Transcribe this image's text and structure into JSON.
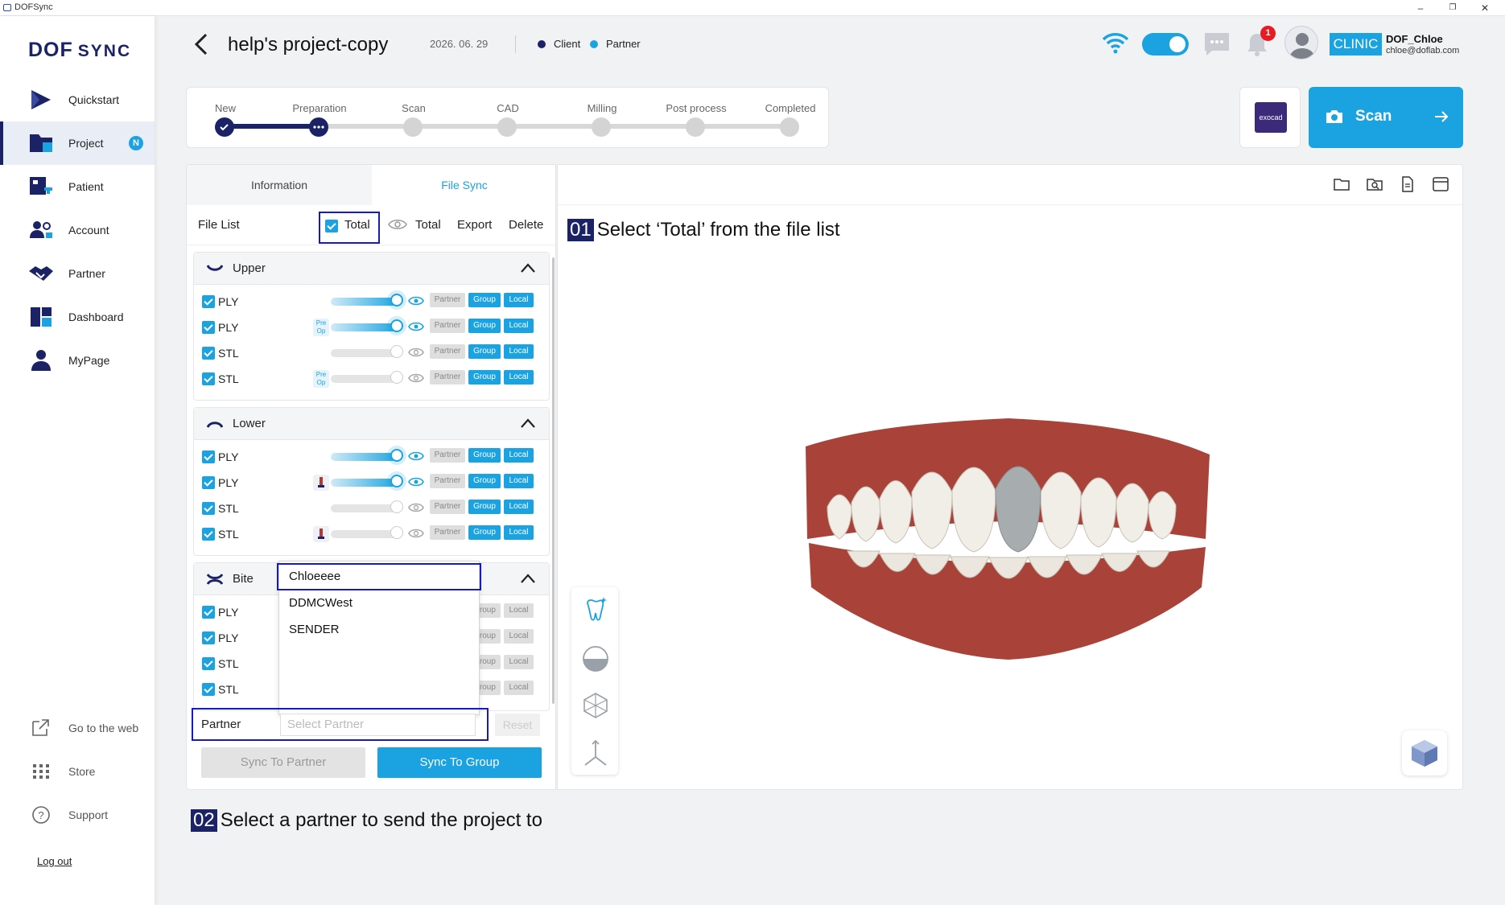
{
  "window": {
    "title": "DOFSync",
    "minimize": "–",
    "restore": "❐",
    "close": "✕"
  },
  "logo": {
    "part1": "DOF",
    "part2": "SYNC"
  },
  "sidebar": {
    "items": [
      {
        "label": "Quickstart",
        "icon": "play-icon"
      },
      {
        "label": "Project",
        "icon": "folder-icon",
        "badge": "N",
        "active": true
      },
      {
        "label": "Patient",
        "icon": "patient-icon"
      },
      {
        "label": "Account",
        "icon": "account-icon"
      },
      {
        "label": "Partner",
        "icon": "handshake-icon"
      },
      {
        "label": "Dashboard",
        "icon": "dashboard-icon"
      },
      {
        "label": "MyPage",
        "icon": "person-icon"
      }
    ],
    "bottom": [
      {
        "label": "Go to the web",
        "icon": "external-link-icon"
      },
      {
        "label": "Store",
        "icon": "grid-icon"
      },
      {
        "label": "Support",
        "icon": "help-icon"
      }
    ],
    "logout": "Log out"
  },
  "header": {
    "title": "help's project-copy",
    "date": "2026. 06. 29",
    "legend": [
      {
        "label": "Client",
        "color": "#1b2366"
      },
      {
        "label": "Partner",
        "color": "#1aa3e0"
      }
    ],
    "notification_count": "1",
    "role": "CLINIC",
    "user_name": "DOF_Chloe",
    "user_email": "chloe@doflab.com"
  },
  "stepper": {
    "steps": [
      "New",
      "Preparation",
      "Scan",
      "CAD",
      "Milling",
      "Post process",
      "Completed"
    ],
    "current_index": 1
  },
  "actions": {
    "exocad_label": "exocad",
    "scan_label": "Scan"
  },
  "tabs": {
    "information": "Information",
    "file_sync": "File Sync"
  },
  "file_list": {
    "label": "File List",
    "total_check": "Total",
    "total_view": "Total",
    "export": "Export",
    "delete": "Delete"
  },
  "chips": {
    "partner": "Partner",
    "group": "Group",
    "local": "Local"
  },
  "groups": [
    {
      "name": "Upper",
      "files": [
        {
          "type": "PLY",
          "tag": "",
          "slider_on": true
        },
        {
          "type": "PLY",
          "tag": "preop",
          "slider_on": true
        },
        {
          "type": "STL",
          "tag": "",
          "slider_on": false
        },
        {
          "type": "STL",
          "tag": "preop",
          "slider_on": false
        }
      ]
    },
    {
      "name": "Lower",
      "files": [
        {
          "type": "PLY",
          "tag": "",
          "slider_on": true
        },
        {
          "type": "PLY",
          "tag": "marker",
          "slider_on": true
        },
        {
          "type": "STL",
          "tag": "",
          "slider_on": false
        },
        {
          "type": "STL",
          "tag": "marker",
          "slider_on": false
        }
      ]
    },
    {
      "name": "Bite",
      "files": [
        {
          "type": "PLY"
        },
        {
          "type": "PLY"
        },
        {
          "type": "STL"
        },
        {
          "type": "STL"
        }
      ]
    }
  ],
  "preop": {
    "line1": "Pre",
    "line2": "Op"
  },
  "partner_dropdown": {
    "options": [
      "Chloeeee",
      "DDMCWest",
      "SENDER"
    ]
  },
  "partner_row": {
    "label": "Partner",
    "placeholder": "Select Partner",
    "reset": "Reset"
  },
  "buttons": {
    "sync_partner": "Sync To Partner",
    "sync_group": "Sync To Group"
  },
  "annotations": [
    {
      "num": "01",
      "text": "Select ‘Total’ from the file list"
    },
    {
      "num": "02",
      "text": "Select a partner to send the project to"
    }
  ]
}
